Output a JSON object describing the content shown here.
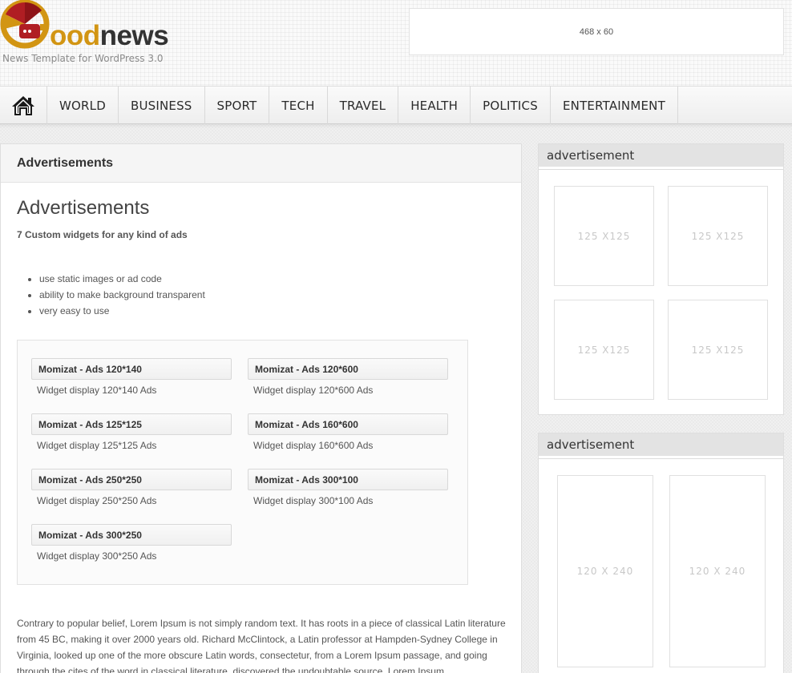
{
  "header": {
    "logo_first_letter_part": "ood",
    "logo_rest": "news",
    "tagline": "News Template for WordPress 3.0",
    "banner_label": "468 x 60"
  },
  "nav": {
    "items": [
      {
        "label": "WORLD"
      },
      {
        "label": "BUSINESS"
      },
      {
        "label": "SPORT"
      },
      {
        "label": "TECH"
      },
      {
        "label": "TRAVEL"
      },
      {
        "label": "HEALTH"
      },
      {
        "label": "POLITICS"
      },
      {
        "label": "ENTERTAINMENT"
      }
    ]
  },
  "main": {
    "header_title": "Advertisements",
    "page_title": "Advertisements",
    "subtitle": "7  Custom widgets for any kind of ads",
    "features": [
      "use static images or ad code",
      "ability to make background transparent",
      "very easy to use"
    ],
    "widgets": [
      {
        "title": "Momizat - Ads 120*140",
        "desc": "Widget display 120*140 Ads"
      },
      {
        "title": "Momizat - Ads 120*600",
        "desc": "Widget display 120*600 Ads"
      },
      {
        "title": "Momizat - Ads 125*125",
        "desc": "Widget display 125*125 Ads"
      },
      {
        "title": "Momizat - Ads 160*600",
        "desc": "Widget display 160*600 Ads"
      },
      {
        "title": "Momizat - Ads 250*250",
        "desc": "Widget display 250*250 Ads"
      },
      {
        "title": "Momizat - Ads 300*100",
        "desc": "Widget display 300*100 Ads"
      },
      {
        "title": "Momizat - Ads 300*250",
        "desc": "Widget display 300*250 Ads"
      }
    ],
    "body_text": "Contrary to popular belief, Lorem Ipsum is not simply random text. It has roots in a piece of classical Latin literature from 45 BC, making it over 2000 years old. Richard McClintock, a Latin professor at Hampden-Sydney College in Virginia, looked up one of the more obscure Latin words, consectetur, from a Lorem Ipsum passage, and going through the cites of the word in classical literature, discovered the undoubtable source. Lorem Ipsum"
  },
  "sidebar": {
    "widget1": {
      "title": "advertisement",
      "ads": [
        "125 X125",
        "125 X125",
        "125 X125",
        "125 X125"
      ]
    },
    "widget2": {
      "title": "advertisement",
      "ads": [
        "120 X 240",
        "120 X 240"
      ]
    }
  },
  "colors": {
    "logo_gold": "#d29513",
    "logo_red": "#b01e23",
    "text": "#555555"
  },
  "icons": {
    "home": "home-icon",
    "logo": "logo-icon"
  }
}
